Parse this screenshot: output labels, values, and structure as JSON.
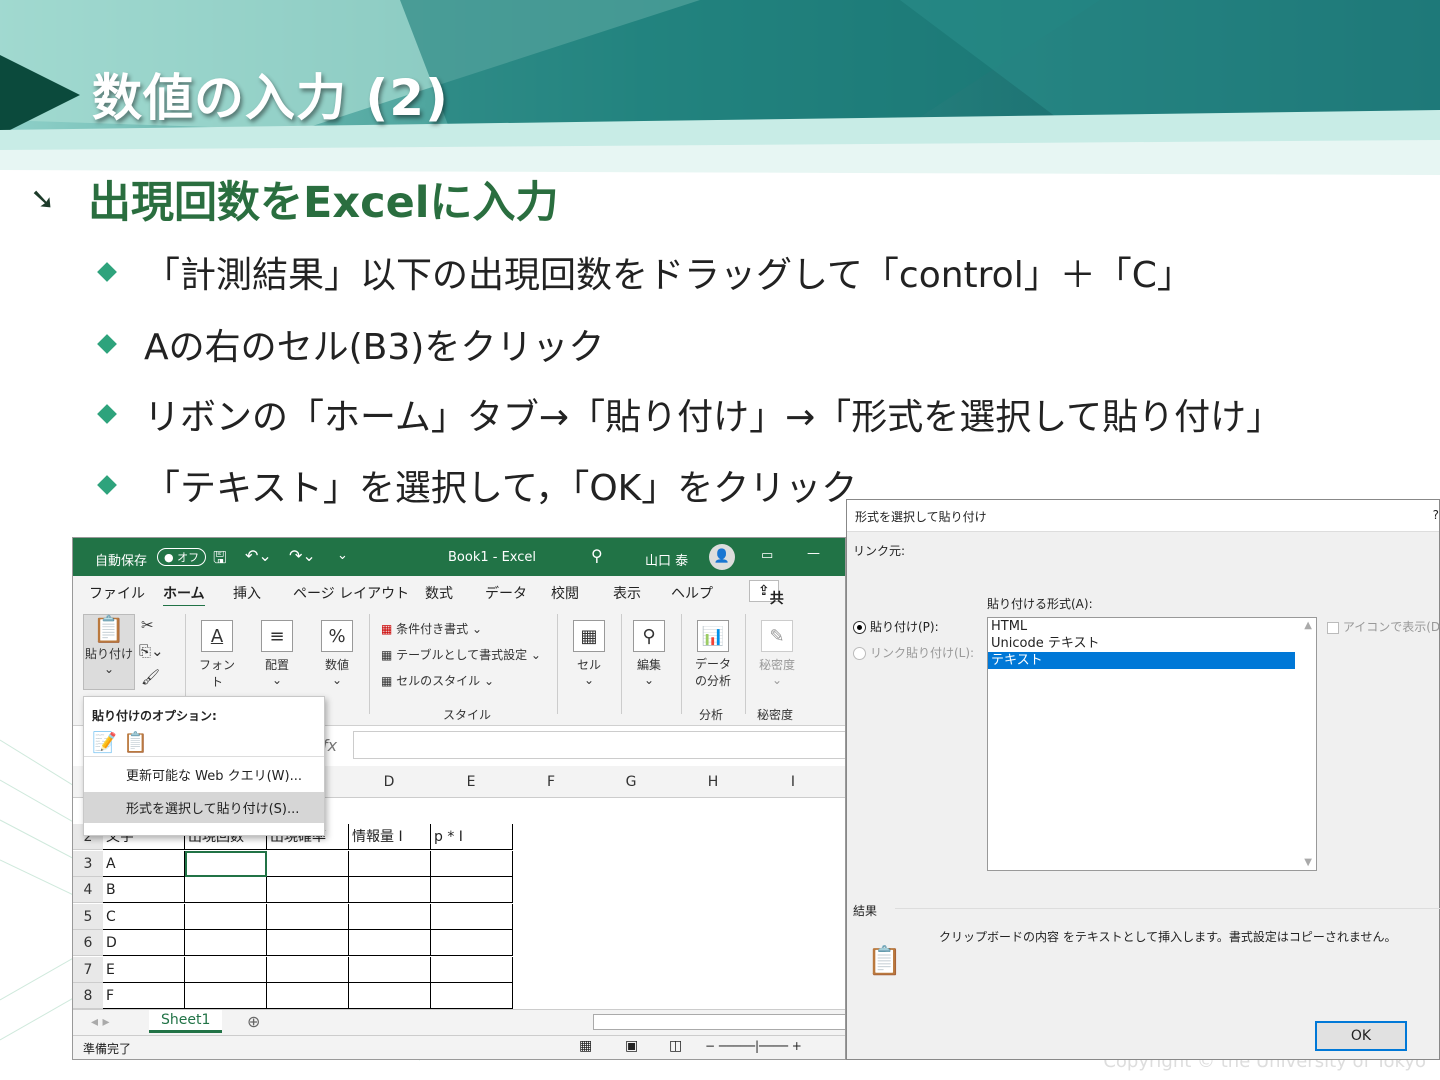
{
  "slide": {
    "title": "数値の入力 (2)",
    "main_bullet": "出現回数をExcelに入力",
    "sub_bullets": [
      "「計測結果」以下の出現回数をドラッグして「control」＋「C」",
      "Aの右のセル(B3)をクリック",
      "リボンの「ホーム」タブ→「貼り付け」→「形式を選択して貼り付け」",
      "「テキスト」を選択して，「OK」をクリック"
    ],
    "copyright": "Copyright © the University of Tokyo",
    "colors": {
      "accent": "#2a6e3f",
      "bullet": "#2ea37c",
      "banner": "#1f7a78"
    }
  },
  "excel": {
    "autosave": "自動保存",
    "autosave_state": "オフ",
    "filename": "Book1  -  Excel",
    "user": "山口 泰",
    "tabs": [
      "ファイル",
      "ホーム",
      "挿入",
      "ページ レイアウト",
      "数式",
      "データ",
      "校閲",
      "表示",
      "ヘルプ"
    ],
    "share": "共有",
    "ribbon": {
      "paste": "貼り付け",
      "font": "フォント",
      "align": "配置",
      "number": "数値",
      "cond_format": "条件付き書式",
      "table_format": "テーブルとして書式設定",
      "cell_style": "セルのスタイル",
      "style_group": "スタイル",
      "cells": "セル",
      "edit": "編集",
      "analyze": "データの分析",
      "analyze_group": "分析",
      "sensitivity": "秘密度",
      "sensitivity_group": "秘密度"
    },
    "paste_menu": {
      "header": "貼り付けのオプション:",
      "web_query": "更新可能な Web クエリ(W)...",
      "paste_special": "形式を選択して貼り付け(S)..."
    },
    "columns": [
      "D",
      "E",
      "F",
      "G",
      "H",
      "I"
    ],
    "rows": [
      {
        "num": "2",
        "cells": [
          "文字",
          "出現回数",
          "出現確率",
          "情報量 I",
          "p * I"
        ]
      },
      {
        "num": "3",
        "cells": [
          "A",
          "",
          "",
          "",
          ""
        ]
      },
      {
        "num": "4",
        "cells": [
          "B",
          "",
          "",
          "",
          ""
        ]
      },
      {
        "num": "5",
        "cells": [
          "C",
          "",
          "",
          "",
          ""
        ]
      },
      {
        "num": "6",
        "cells": [
          "D",
          "",
          "",
          "",
          ""
        ]
      },
      {
        "num": "7",
        "cells": [
          "E",
          "",
          "",
          "",
          ""
        ]
      },
      {
        "num": "8",
        "cells": [
          "F",
          "",
          "",
          "",
          ""
        ]
      }
    ],
    "sheet": "Sheet1",
    "status": "準備完了"
  },
  "dialog": {
    "title": "形式を選択して貼り付け",
    "help": "?",
    "link_source": "リンク元:",
    "formats_label": "貼り付ける形式(A):",
    "paste_radio": "貼り付け(P):",
    "link_radio": "リンク貼り付け(L):",
    "formats": [
      "HTML",
      "Unicode テキスト",
      "テキスト"
    ],
    "selected_index": 2,
    "icon_check": "アイコンで表示(D",
    "result_label": "結果",
    "result_text": "クリップボードの内容 をテキストとして挿入します。書式設定はコピーされません。",
    "ok": "OK"
  }
}
